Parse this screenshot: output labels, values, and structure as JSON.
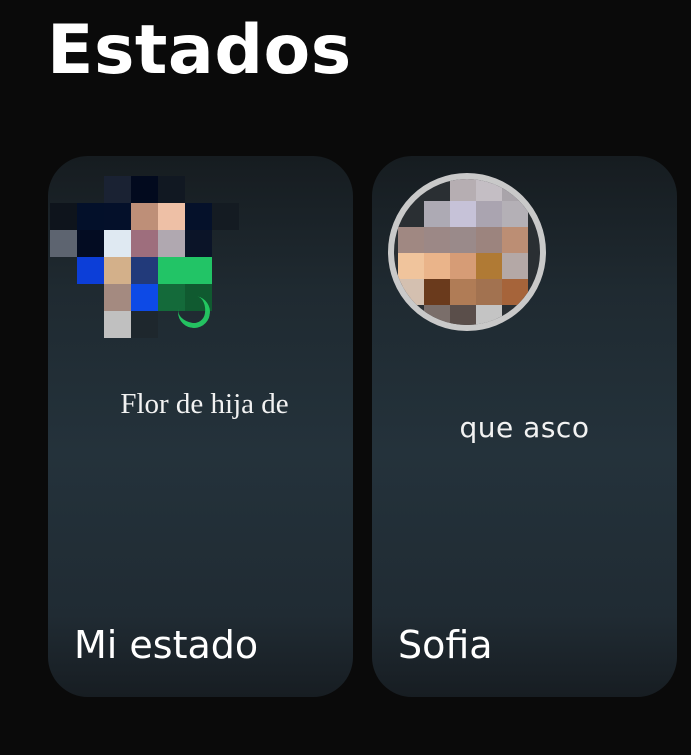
{
  "header": {
    "title": "Estados"
  },
  "statuses": [
    {
      "label": "Mi estado",
      "text": "Flor de hija de",
      "avatar_icon": "pixelated-avatar-icon",
      "badge_icon": "add-status-icon"
    },
    {
      "label": "Sofia",
      "text": "que asco",
      "avatar_icon": "pixelated-avatar-icon",
      "ring_color": "#c9c9c9"
    }
  ],
  "colors": {
    "background": "#0a0a0a",
    "accent": "#25d366",
    "text": "#ffffff"
  }
}
